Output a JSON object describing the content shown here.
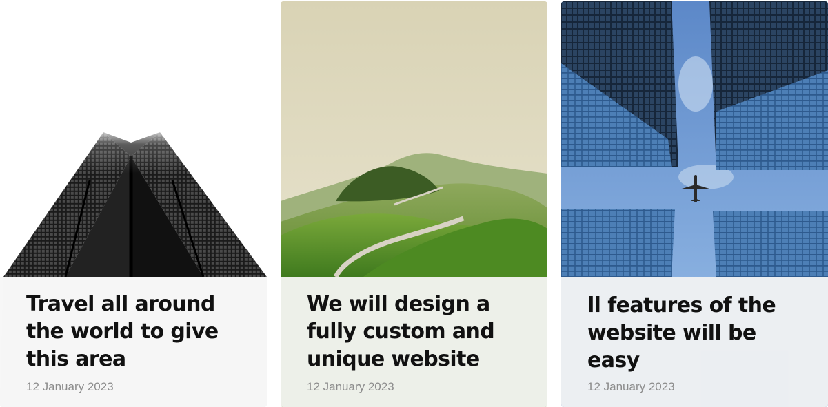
{
  "posts": [
    {
      "image": "black skyscraper from below against white sky",
      "title": "Travel all around the world to give this area",
      "date": "12 January 2023"
    },
    {
      "image": "green hills with winding road",
      "title": "We will design a fully custom and unique website",
      "date": "12 January 2023"
    },
    {
      "image": "glass skyscrapers from below with airplane in blue sky",
      "title": "ll features of the website will be easy",
      "date": "12 January 2023"
    }
  ],
  "colors": {
    "title": "#111111",
    "date": "#8c8c8c",
    "card_body_bg": "#f6f6f6"
  }
}
